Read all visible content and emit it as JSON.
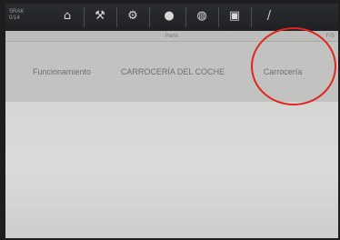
{
  "device": {
    "brand_label": "SRAK\n0/14"
  },
  "toolbar": {
    "items": [
      {
        "icon": "home-icon",
        "glyph": "⌂"
      },
      {
        "icon": "tools-icon",
        "glyph": "⚒"
      },
      {
        "icon": "settings-icon",
        "glyph": "⚙"
      },
      {
        "icon": "car-icon",
        "glyph": "●"
      },
      {
        "icon": "globe-icon",
        "glyph": "◍"
      },
      {
        "icon": "save-icon",
        "glyph": "▣"
      },
      {
        "icon": "edit-icon",
        "glyph": "/"
      }
    ]
  },
  "header": {
    "title": "Parte",
    "corner": "F/S"
  },
  "options": [
    {
      "label": "Funcionamiento"
    },
    {
      "label": "CARROCERÍA DEL COCHE"
    },
    {
      "label": "Carrocería"
    }
  ],
  "annotation": {
    "color": "#e0261e",
    "target": "Carrocería"
  }
}
